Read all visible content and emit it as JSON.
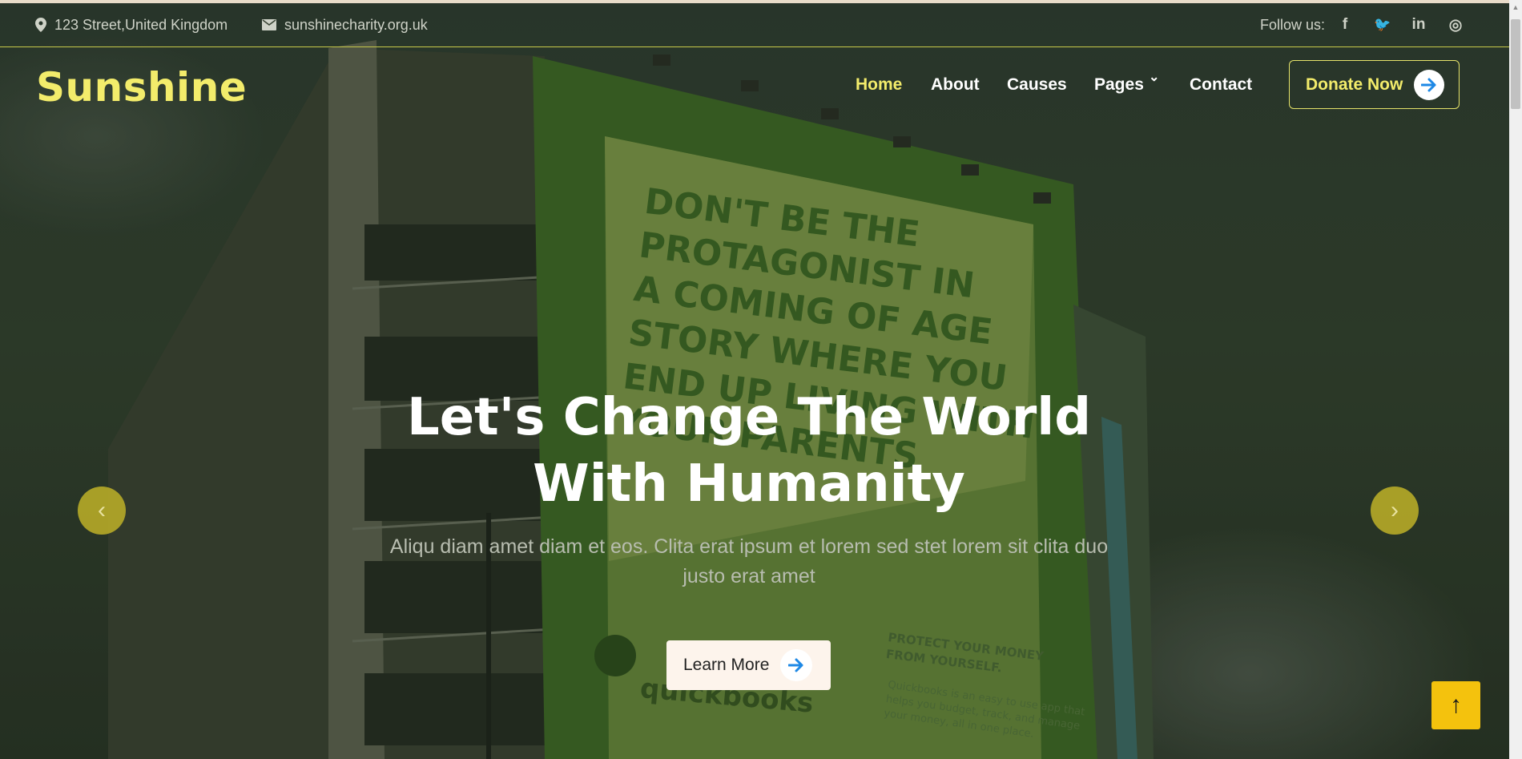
{
  "topbar": {
    "address": "123 Street,United Kingdom",
    "email": "sunshinecharity.org.uk",
    "follow_label": "Follow us:",
    "socials": [
      {
        "name": "facebook-icon",
        "glyph": "f"
      },
      {
        "name": "twitter-icon",
        "glyph": "🐦"
      },
      {
        "name": "linkedin-icon",
        "glyph": "in"
      },
      {
        "name": "instagram-icon",
        "glyph": "◎"
      }
    ]
  },
  "brand": {
    "logo": "Sunshine"
  },
  "nav": {
    "items": [
      "Home",
      "About",
      "Causes",
      "Pages",
      "Contact"
    ],
    "active": "Home",
    "pages_dropdown_glyph": "⌄"
  },
  "donate": {
    "label": "Donate Now",
    "icon": "arrow-right-icon"
  },
  "hero": {
    "title_line1": "Let's Change The World",
    "title_line2": "With Humanity",
    "subtitle": "Aliqu diam amet diam et eos. Clita erat ipsum et lorem sed stet lorem sit clita duo justo erat amet",
    "cta_label": "Learn More"
  },
  "carousel": {
    "prev_glyph": "‹",
    "next_glyph": "›"
  },
  "back_to_top_glyph": "↑",
  "billboard": {
    "lines": [
      "DON'T BE THE",
      "PROTAGONIST IN",
      "A COMING OF AGE",
      "STORY WHERE YOU",
      "END UP LIVING WITH",
      "YOUR PARENTS"
    ],
    "brand": "quickbooks",
    "tagline_lines": [
      "PROTECT YOUR MONEY",
      "FROM YOURSELF."
    ],
    "fine_print_lines": [
      "Quickbooks is an easy to use app that",
      "helps you budget, track, and manage",
      "your money, all in one place."
    ]
  },
  "colors": {
    "accent": "#f3ec6b",
    "cta_bg": "#fdf4ec",
    "to_top": "#f4c20d",
    "arrow_blue": "#1e88e5"
  }
}
